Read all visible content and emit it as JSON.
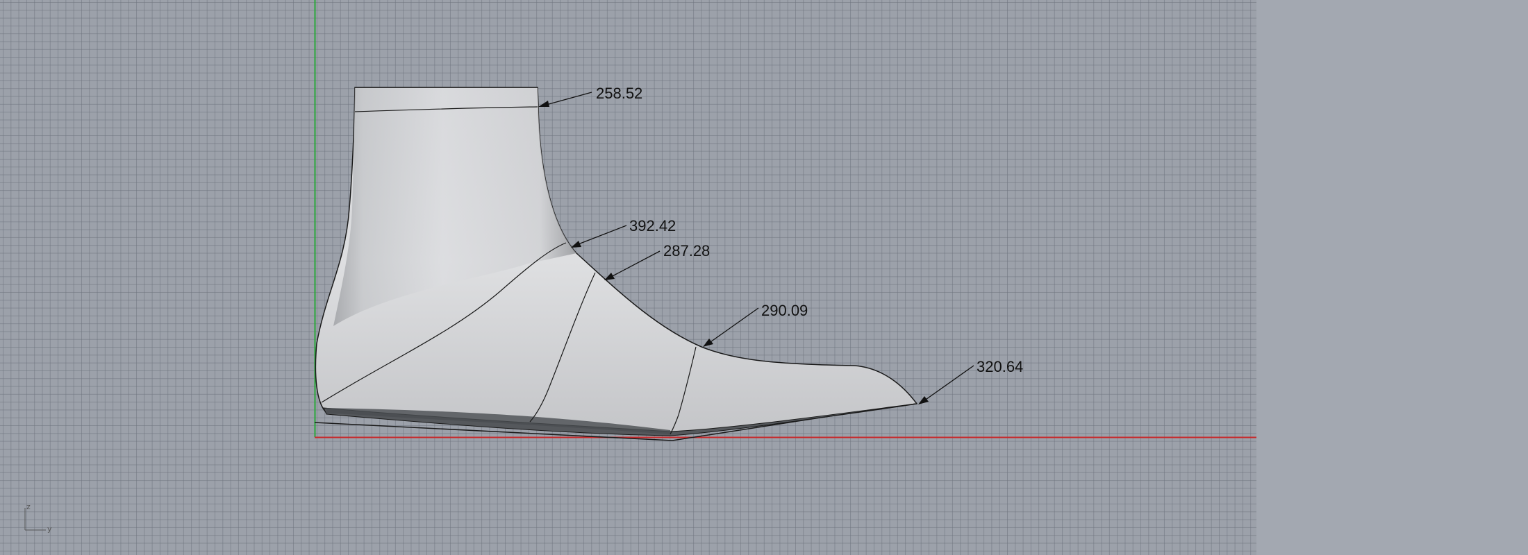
{
  "viewport": {
    "background_color": "#9ca1aa",
    "grid_color": "#6e747e",
    "x_axis_color": "#c8282a",
    "y_axis_color": "#29a83a"
  },
  "model": {
    "surface_color": "#d9dadc",
    "sole_color": "#55585c",
    "edge_color": "#1a1a1a"
  },
  "dimensions": [
    {
      "id": "top-opening",
      "value": "258.52"
    },
    {
      "id": "ankle",
      "value": "392.42"
    },
    {
      "id": "instep",
      "value": "287.28"
    },
    {
      "id": "ball",
      "value": "290.09"
    },
    {
      "id": "toe",
      "value": "320.64"
    }
  ],
  "axis_indicator": {
    "vertical_label": "z",
    "horizontal_label": "y"
  }
}
